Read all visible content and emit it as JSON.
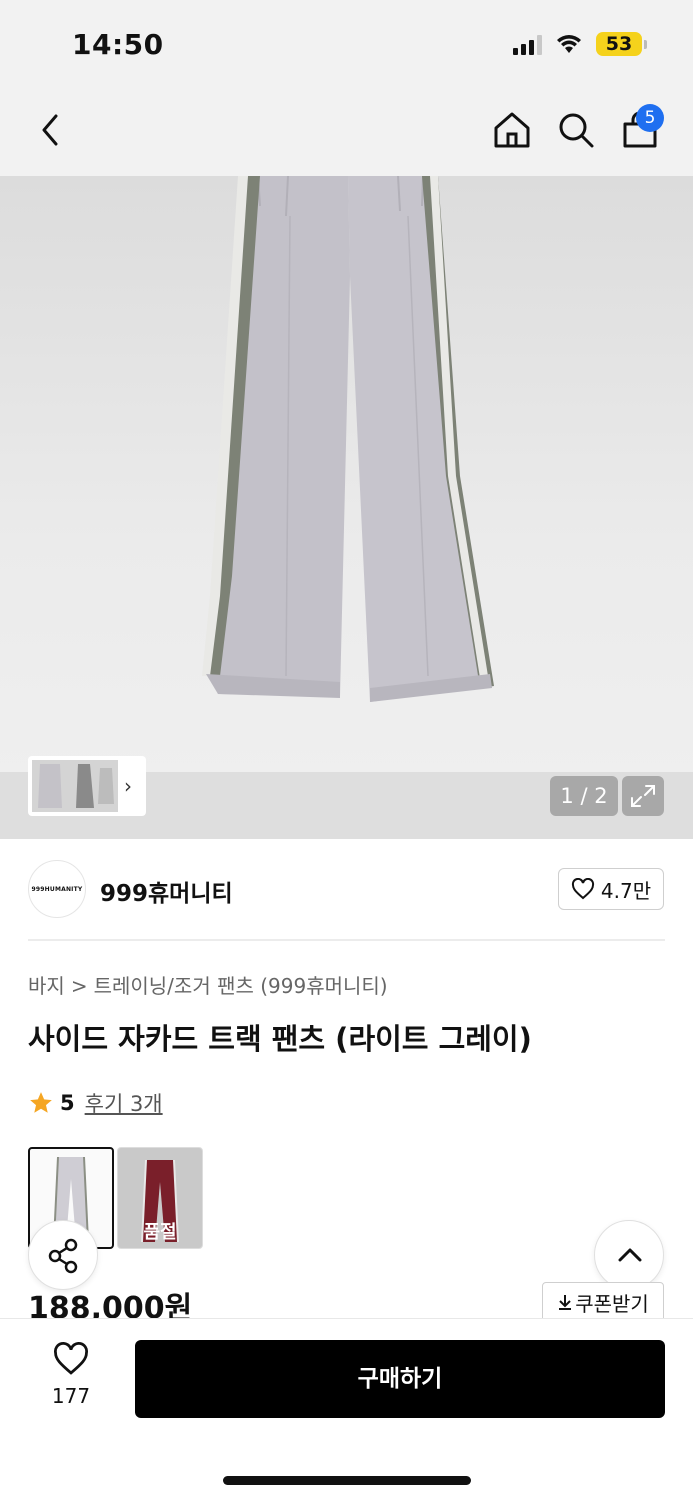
{
  "status_bar": {
    "time": "14:50",
    "battery": "53",
    "icons": [
      "signal-icon",
      "wifi-icon",
      "battery-icon"
    ]
  },
  "nav": {
    "icons": [
      "back-icon",
      "home-icon",
      "search-icon",
      "shopping-bag-icon"
    ],
    "cart_badge": "5"
  },
  "gallery": {
    "page_counter": "1 / 2",
    "icons": [
      "chevron-right-icon",
      "expand-icon"
    ]
  },
  "brand": {
    "logo_text": "999HUMANITY",
    "name": "999휴머니티",
    "likes": "4.7만"
  },
  "product": {
    "breadcrumb": [
      "바지",
      "트레이닝/조거 팬츠 (999휴머니티)"
    ],
    "breadcrumb_sep": ">",
    "title": "사이드 자카드 트랙 팬츠 (라이트 그레이)",
    "rating": "5",
    "reviews": "후기 3개",
    "options": [
      {
        "color": "light gray",
        "selected": true
      },
      {
        "color": "burgundy",
        "selected": false,
        "status": "품절"
      }
    ],
    "price": "188,000원",
    "coupon": "쿠폰받기"
  },
  "bottom_bar": {
    "wish_count": "177",
    "buy_label": "구매하기"
  },
  "colors": {
    "accent_badge": "#1f6ff0",
    "battery": "#f5d21c",
    "star": "#f5a623",
    "buy_button": "#000000"
  }
}
